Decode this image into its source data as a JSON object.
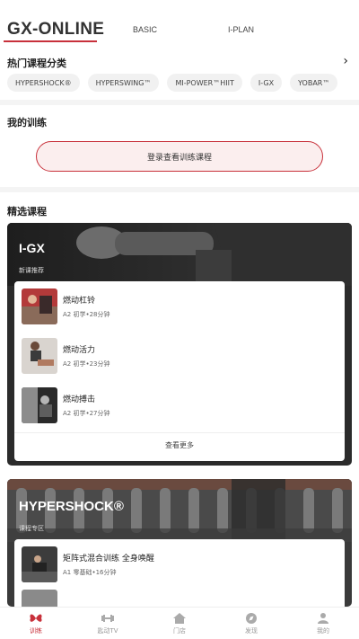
{
  "header": {
    "brand": "GX-ONLINE",
    "tabs": [
      "BASIC",
      "I-PLAN"
    ]
  },
  "hot_categories": {
    "title": "热门课程分类",
    "chips": [
      "HYPERSHOCK®",
      "HYPERSWING™",
      "MI-POWER™HIIT",
      "I-GX",
      "YOBAR™"
    ]
  },
  "my_training": {
    "title": "我的训练",
    "login_label": "登录查看训练课程"
  },
  "featured": {
    "title": "精选课程",
    "cards": [
      {
        "title": "I-GX",
        "subtitle": "新课推荐",
        "items": [
          {
            "title": "燃动杠铃",
            "meta": "A2 初学•28分钟"
          },
          {
            "title": "燃动活力",
            "meta": "A2 初学•23分钟"
          },
          {
            "title": "燃动搏击",
            "meta": "A2 初学•27分钟"
          }
        ],
        "more": "查看更多"
      },
      {
        "title": "HYPERSHOCK®",
        "subtitle": "课程专区",
        "items": [
          {
            "title": "矩阵式混合训练 全身唤醒",
            "meta": "A1 零基础•16分钟"
          },
          {
            "title": "",
            "meta": ""
          }
        ]
      }
    ]
  },
  "bottom_nav": [
    {
      "label": "训练",
      "icon": "butterfly-icon",
      "active": true
    },
    {
      "label": "匙动TV",
      "icon": "dumbbell-icon",
      "active": false
    },
    {
      "label": "门店",
      "icon": "home-icon",
      "active": false
    },
    {
      "label": "发现",
      "icon": "compass-icon",
      "active": false
    },
    {
      "label": "我的",
      "icon": "person-icon",
      "active": false
    }
  ],
  "colors": {
    "accent": "#c8313b",
    "card_dark": "#2b2b2b"
  }
}
